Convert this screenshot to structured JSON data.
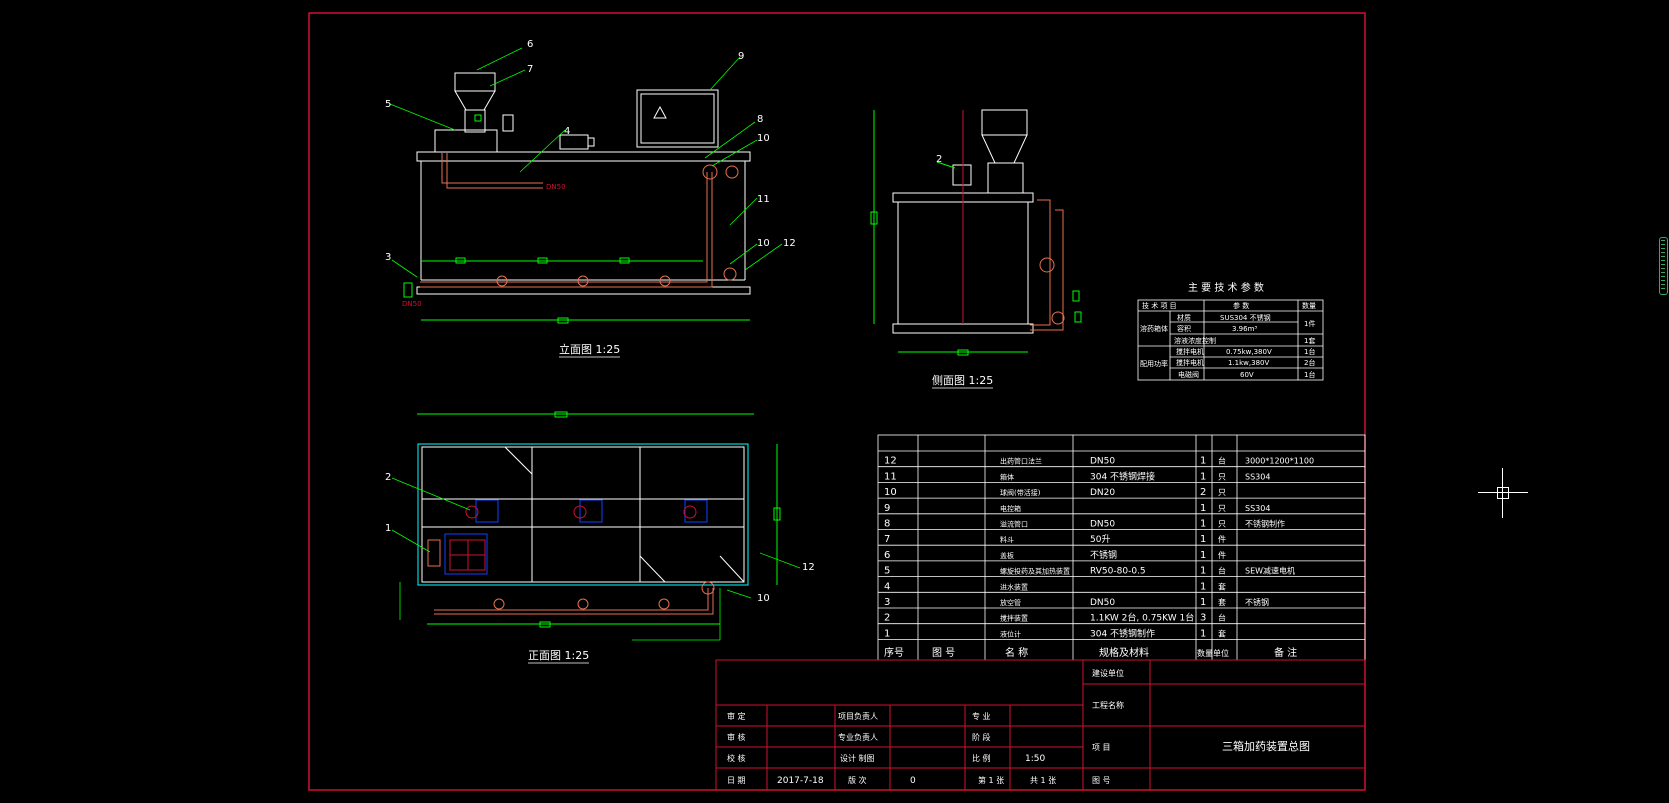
{
  "view_titles": {
    "elevation": "立面图 1:25",
    "side": "侧面图 1:25",
    "plan": "正面图 1:25"
  },
  "callouts": {
    "elevation": [
      "6",
      "7",
      "5",
      "4",
      "9",
      "8",
      "10",
      "11",
      "3",
      "10",
      "12"
    ],
    "side": [
      "2"
    ],
    "plan": [
      "2",
      "1",
      "12",
      "10"
    ]
  },
  "pipe_labels": {
    "out": "DN50",
    "in": "DN50"
  },
  "tech_params": {
    "title": "主 要 技 术 参 数",
    "headers": [
      "技 术 项 目",
      "参  数",
      "数量"
    ],
    "group1": "溶药箱体",
    "group2": "配用功率",
    "rows": [
      {
        "item": "材质",
        "param": "SUS304 不锈钢",
        "qty": "1件"
      },
      {
        "item": "容积",
        "param": "3.96m³",
        "qty": ""
      },
      {
        "item": "溶液浓度控制",
        "param": "",
        "qty": "1套"
      },
      {
        "item": "搅拌电机",
        "param": "0.75kw,380V",
        "qty": "1台"
      },
      {
        "item": "搅拌电机",
        "param": "1.1kw,380V",
        "qty": "2台"
      },
      {
        "item": "电磁阀",
        "param": "60V",
        "qty": "1台"
      }
    ]
  },
  "bom": {
    "headers": [
      "序号",
      "图  号",
      "名    称",
      "规格及材料",
      "数量",
      "单位",
      "备  注"
    ],
    "rows": [
      {
        "no": "12",
        "name": "出药管口法兰",
        "spec": "DN50",
        "qty": "1",
        "unit": "台",
        "note": "3000*1200*1100"
      },
      {
        "no": "11",
        "name": "箱体",
        "spec": "304 不锈钢焊接",
        "qty": "1",
        "unit": "只",
        "note": "SS304"
      },
      {
        "no": "10",
        "name": "球阀(带活接)",
        "spec": "DN20",
        "qty": "2",
        "unit": "只",
        "note": ""
      },
      {
        "no": "9",
        "name": "电控箱",
        "spec": "",
        "qty": "1",
        "unit": "只",
        "note": "SS304"
      },
      {
        "no": "8",
        "name": "溢流管口",
        "spec": "DN50",
        "qty": "1",
        "unit": "只",
        "note": "不锈钢制作"
      },
      {
        "no": "7",
        "name": "料斗",
        "spec": "50升",
        "qty": "1",
        "unit": "件",
        "note": ""
      },
      {
        "no": "6",
        "name": "盖板",
        "spec": "不锈钢",
        "qty": "1",
        "unit": "件",
        "note": ""
      },
      {
        "no": "5",
        "name": "螺旋投药及其加热装置",
        "spec": "RV50-80-0.5",
        "qty": "1",
        "unit": "台",
        "note": "SEW减速电机"
      },
      {
        "no": "4",
        "name": "进水装置",
        "spec": "",
        "qty": "1",
        "unit": "套",
        "note": ""
      },
      {
        "no": "3",
        "name": "放空管",
        "spec": "DN50",
        "qty": "1",
        "unit": "套",
        "note": "不锈钢"
      },
      {
        "no": "2",
        "name": "搅拌装置",
        "spec": "1.1KW 2台, 0.75KW 1台",
        "qty": "3",
        "unit": "台",
        "note": ""
      },
      {
        "no": "1",
        "name": "液位计",
        "spec": "304 不锈钢制作",
        "qty": "1",
        "unit": "套",
        "note": ""
      }
    ]
  },
  "title_block": {
    "design_unit": "建设单位",
    "project_name": "工程名称",
    "item_name": "项  目",
    "drawing_title": "三箱加药装置总图",
    "approve": "审  定",
    "review": "审  核",
    "check": "校  核",
    "date_label": "日  期",
    "date": "2017-7-18",
    "proj_lead": "项目负责人",
    "spec_lead": "专业负责人",
    "design_draw": "设计 制图",
    "version_label": "版  次",
    "version": "0",
    "discipline": "专  业",
    "stage": "阶  段",
    "scale_label": "比  例",
    "scale": "1:50",
    "sheet": "第 1 张",
    "total": "共 1 张",
    "drawing_no": "图  号"
  }
}
